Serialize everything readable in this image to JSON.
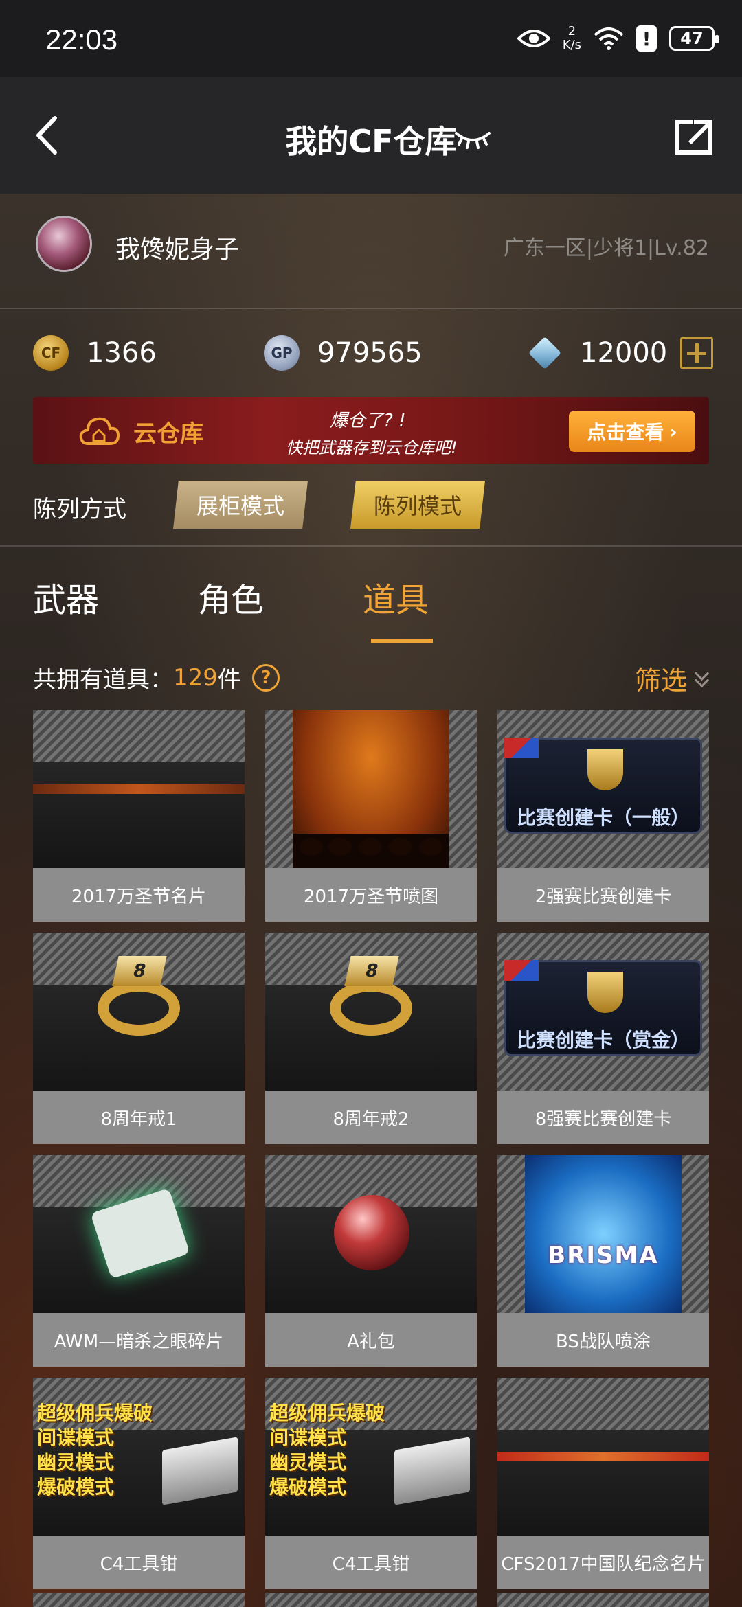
{
  "status_bar": {
    "time": "22:03",
    "net_speed_value": "2",
    "net_speed_unit": "K/s",
    "battery": "47",
    "alert": "!"
  },
  "header": {
    "title": "我的CF仓库"
  },
  "user": {
    "name": "我馋妮身子",
    "server_info": "广东一区|少将1|Lv.82"
  },
  "currency": {
    "cf_points": "1366",
    "cf_label": "CF",
    "gp": "979565",
    "gp_label": "GP",
    "diamonds": "12000"
  },
  "banner": {
    "title": "云仓库",
    "slogan_line1": "爆仓了? !",
    "slogan_line2": "快把武器存到云仓库吧!",
    "button": "点击查看"
  },
  "display_mode": {
    "label": "陈列方式",
    "options": [
      "展柜模式",
      "陈列模式"
    ],
    "selected": "陈列模式"
  },
  "tabs": [
    {
      "label": "武器",
      "active": false
    },
    {
      "label": "角色",
      "active": false
    },
    {
      "label": "道具",
      "active": true
    }
  ],
  "inventory": {
    "count_prefix": "共拥有道具：",
    "count": "129",
    "count_suffix": "件",
    "help": "?",
    "filter": "筛选"
  },
  "items": [
    {
      "name": "2017万圣节名片"
    },
    {
      "name": "2017万圣节喷图"
    },
    {
      "name": "2强赛比赛创建卡",
      "art_text": "比赛创建卡（一般）"
    },
    {
      "name": "8周年戒1",
      "art_text": "8"
    },
    {
      "name": "8周年戒2",
      "art_text": "8"
    },
    {
      "name": "8强赛比赛创建卡",
      "art_text": "比赛创建卡（赏金）"
    },
    {
      "name": "AWM—暗杀之眼碎片"
    },
    {
      "name": "A礼包"
    },
    {
      "name": "BS战队喷涂",
      "art_text": "BRISMA"
    },
    {
      "name": "C4工具钳",
      "art_text": "超级佣兵爆破\n间谍模式\n幽灵模式\n爆破模式"
    },
    {
      "name": "C4工具钳",
      "art_text": "超级佣兵爆破\n间谍模式\n幽灵模式\n爆破模式"
    },
    {
      "name": "CFS2017中国队纪念名片"
    }
  ],
  "colors": {
    "accent": "#f0a336",
    "header_bg": "#262628",
    "status_bg": "#1c1c1e",
    "label_bg": "#8d8d8d"
  }
}
